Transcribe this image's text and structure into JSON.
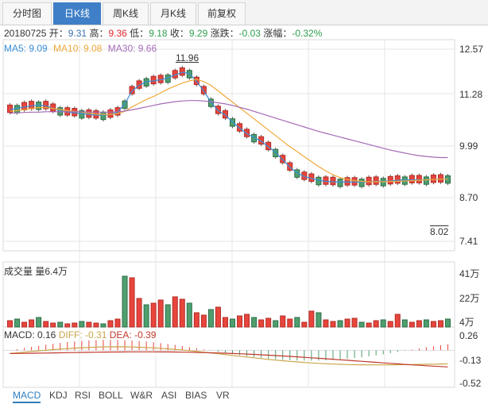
{
  "tabs": [
    {
      "label": "分时图",
      "active": false
    },
    {
      "label": "日K线",
      "active": true
    },
    {
      "label": "周K线",
      "active": false
    },
    {
      "label": "月K线",
      "active": false
    },
    {
      "label": "前复权",
      "active": false
    }
  ],
  "info": {
    "date": "20180725",
    "open_label": "开：",
    "open": "9.31",
    "high_label": "高：",
    "high": "9.36",
    "low_label": "低：",
    "low": "9.18",
    "close_label": "收：",
    "close": "9.29",
    "change_label": "涨跌：",
    "change": "-0.03",
    "pct_label": "涨幅：",
    "pct": "-0.32%"
  },
  "ma": {
    "ma5": "MA5: 9.09",
    "ma10": "MA10: 9.08",
    "ma30": "MA30: 9.66",
    "colors": {
      "ma5": "#3a8fd8",
      "ma10": "#f0a93a",
      "ma30": "#a56ab8"
    }
  },
  "price_axis": [
    "12.57",
    "11.28",
    "9.99",
    "8.70",
    "7.41"
  ],
  "price_marks": {
    "high": "11.96",
    "low": "8.02"
  },
  "volume": {
    "title": "成交量 量6.4万",
    "axis": [
      "41万",
      "22万",
      "4万"
    ]
  },
  "macd": {
    "label": "MACD: 0.16",
    "diff": "DIFF: -0.31",
    "dea": "DEA: -0.39",
    "axis": [
      "0.26",
      "-0.13",
      "-0.52"
    ],
    "colors": {
      "diff": "#c9a64a",
      "dea": "#c0392b"
    }
  },
  "indicator_tabs": [
    {
      "label": "MACD",
      "active": true
    },
    {
      "label": "KDJ",
      "active": false
    },
    {
      "label": "RSI",
      "active": false
    },
    {
      "label": "BOLL",
      "active": false
    },
    {
      "label": "W&R",
      "active": false
    },
    {
      "label": "ASI",
      "active": false
    },
    {
      "label": "BIAS",
      "active": false
    },
    {
      "label": "VR",
      "active": false
    }
  ],
  "colors": {
    "up": "#e8453c",
    "down": "#4f9f6e",
    "grid": "#e6e6e6"
  },
  "chart_data": [
    {
      "type": "candlestick",
      "title": "",
      "ylim": [
        7.41,
        12.57
      ],
      "yticks": [
        12.57,
        11.28,
        9.99,
        8.7,
        7.41
      ],
      "series": [
        {
          "name": "MA5",
          "values": [
            10.95,
            10.98,
            11.02,
            11.05,
            11.07,
            11.05,
            10.98,
            10.92,
            10.88,
            10.86,
            10.84,
            10.82,
            10.8,
            10.8,
            10.82,
            10.88,
            11.1,
            11.45,
            11.6,
            11.7,
            11.72,
            11.75,
            11.8,
            11.88,
            11.95,
            11.92,
            11.7,
            11.45,
            11.15,
            10.92,
            10.8,
            10.62,
            10.45,
            10.3,
            10.2,
            10.1,
            9.95,
            9.8,
            9.6,
            9.4,
            9.25,
            9.15,
            9.1,
            9.05,
            9.02,
            9.01,
            9.0,
            9.0,
            9.0,
            9.0,
            9.01,
            9.02,
            9.02,
            9.03,
            9.05,
            9.06,
            9.06,
            9.06,
            9.06,
            9.07,
            9.08,
            9.09
          ]
        },
        {
          "name": "MA10",
          "values": [
            10.9,
            10.92,
            10.95,
            10.98,
            11.0,
            11.0,
            10.98,
            10.95,
            10.92,
            10.9,
            10.88,
            10.85,
            10.83,
            10.82,
            10.82,
            10.84,
            10.9,
            11.02,
            11.12,
            11.22,
            11.3,
            11.4,
            11.5,
            11.58,
            11.66,
            11.72,
            11.76,
            11.7,
            11.6,
            11.45,
            11.3,
            11.15,
            11.0,
            10.85,
            10.7,
            10.55,
            10.4,
            10.25,
            10.1,
            9.95,
            9.82,
            9.68,
            9.55,
            9.42,
            9.3,
            9.2,
            9.12,
            9.07,
            9.04,
            9.02,
            9.01,
            9.01,
            9.01,
            9.02,
            9.02,
            9.03,
            9.04,
            9.05,
            9.06,
            9.07,
            9.08,
            9.08
          ]
        },
        {
          "name": "MA30",
          "values": [
            10.85,
            10.86,
            10.87,
            10.88,
            10.88,
            10.89,
            10.89,
            10.89,
            10.89,
            10.89,
            10.89,
            10.88,
            10.88,
            10.88,
            10.88,
            10.89,
            10.91,
            10.94,
            10.98,
            11.02,
            11.06,
            11.1,
            11.13,
            11.16,
            11.18,
            11.19,
            11.19,
            11.18,
            11.16,
            11.13,
            11.1,
            11.06,
            11.01,
            10.96,
            10.9,
            10.84,
            10.78,
            10.72,
            10.66,
            10.6,
            10.54,
            10.48,
            10.42,
            10.36,
            10.31,
            10.26,
            10.21,
            10.16,
            10.11,
            10.06,
            10.01,
            9.96,
            9.91,
            9.86,
            9.82,
            9.78,
            9.74,
            9.71,
            9.69,
            9.67,
            9.66,
            9.66
          ]
        }
      ]
    },
    {
      "type": "bar",
      "title": "成交量",
      "ylim": [
        0,
        45
      ],
      "yticks_labels": [
        "41万",
        "22万",
        "4万"
      ]
    },
    {
      "type": "line",
      "title": "MACD",
      "ylim": [
        -0.52,
        0.26
      ],
      "yticks": [
        0.26,
        -0.13,
        -0.52
      ]
    }
  ]
}
